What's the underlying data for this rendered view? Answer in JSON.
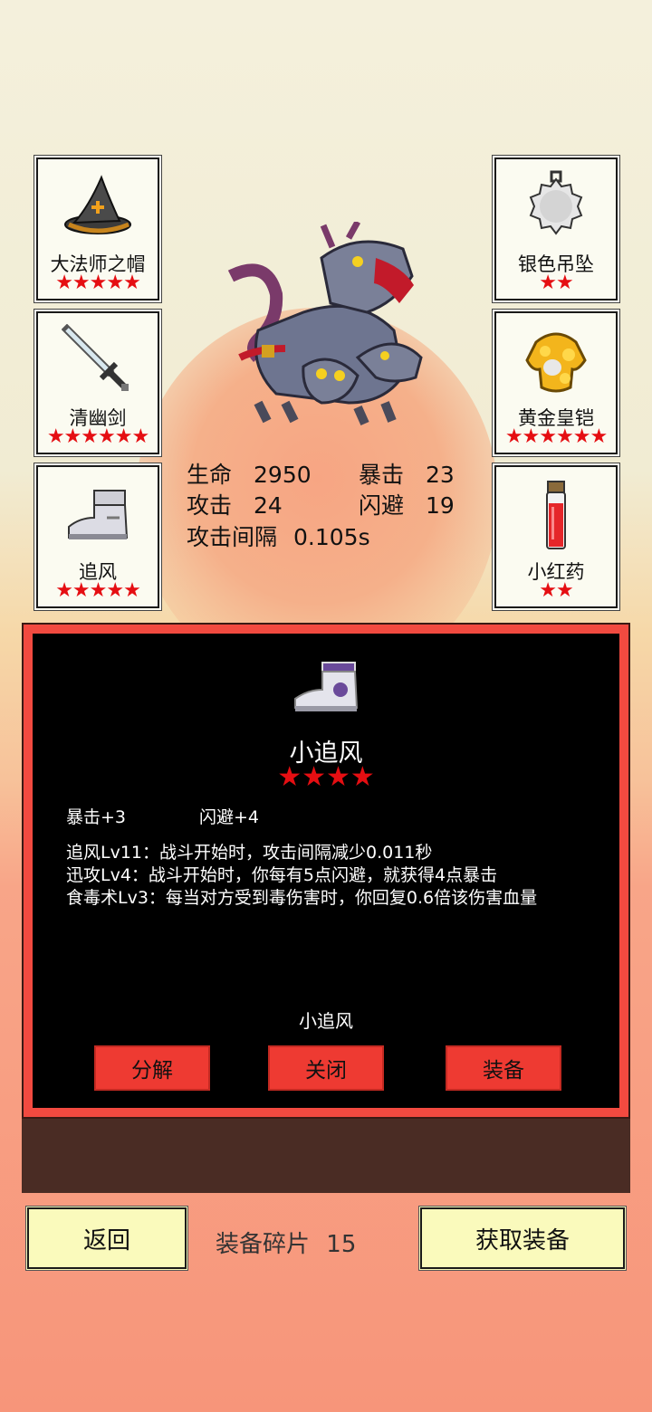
{
  "equipment": {
    "left": [
      {
        "name": "大法师之帽",
        "stars": "★★★★★",
        "icon": "wizard-hat-icon"
      },
      {
        "name": "清幽剑",
        "stars": "★★★★★★",
        "icon": "sword-icon"
      },
      {
        "name": "追风",
        "stars": "★★★★★",
        "icon": "boot-icon"
      }
    ],
    "right": [
      {
        "name": "银色吊坠",
        "stars": "★★",
        "icon": "silver-pendant-icon"
      },
      {
        "name": "黄金皇铠",
        "stars": "★★★★★★",
        "icon": "gold-armor-icon"
      },
      {
        "name": "小红药",
        "stars": "★★",
        "icon": "red-potion-icon"
      }
    ]
  },
  "stats": {
    "hp_label": "生命",
    "hp": "2950",
    "crit_label": "暴击",
    "crit": "23",
    "atk_label": "攻击",
    "atk": "24",
    "dodge_label": "闪避",
    "dodge": "19",
    "interval_label": "攻击间隔",
    "interval": "0.105s"
  },
  "detail": {
    "title": "小追风",
    "stars": "★★★★",
    "bonus1": "暴击+3",
    "bonus2": "闪避+4",
    "skills": [
      "追风Lv11：战斗开始时，攻击间隔减少0.011秒",
      "迅攻Lv4：战斗开始时，你每有5点闪避，就获得4点暴击",
      "食毒术Lv3：每当对方受到毒伤害时，你回复0.6倍该伤害血量"
    ],
    "caption": "小追风",
    "buttons": {
      "decompose": "分解",
      "close": "关闭",
      "equip": "装备"
    }
  },
  "footer": {
    "back": "返回",
    "fragments_label": "装备碎片",
    "fragments": "15",
    "get_equipment": "获取装备"
  },
  "colors": {
    "star": "#e50e12",
    "button": "#ee3a32",
    "panel_border": "#f24a40",
    "bottom_button": "#fafabc"
  }
}
